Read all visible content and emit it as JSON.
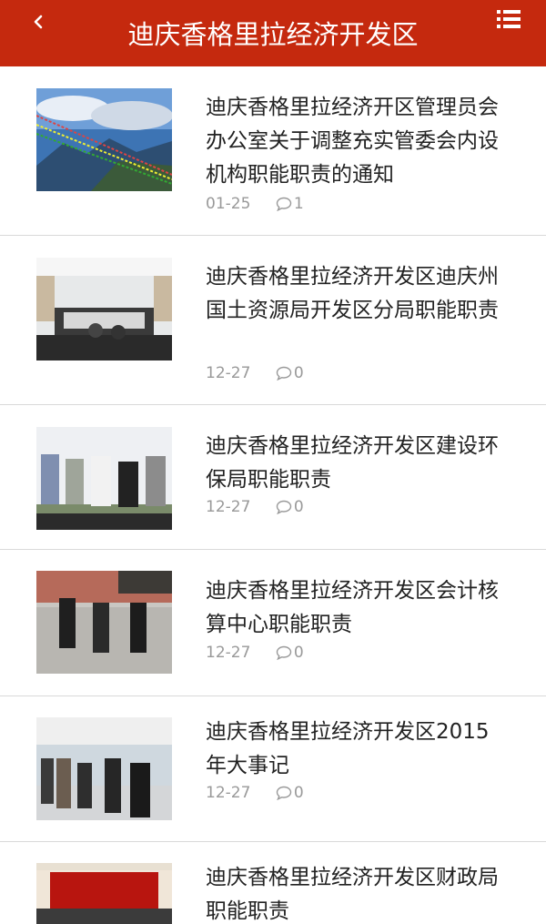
{
  "header": {
    "title": "迪庆香格里拉经济开发区",
    "back_icon": "chevron-left-icon",
    "menu_icon": "list-icon",
    "color": "#c5290e"
  },
  "articles": [
    {
      "title": "迪庆香格里拉经济开区管理员会办公室关于调整充实管委会内设机构职能职责的通知",
      "date": "01-25",
      "comments": "1",
      "image": "mountain-prayer-flags"
    },
    {
      "title": "迪庆香格里拉经济开发区迪庆州国土资源局开发区分局职能职责",
      "date": "12-27",
      "comments": "0",
      "image": "conference-room-meeting"
    },
    {
      "title": "迪庆香格里拉经济开发区建设环保局职能职责",
      "date": "12-27",
      "comments": "0",
      "image": "officials-outdoor-inspection"
    },
    {
      "title": "迪庆香格里拉经济开发区会计核算中心职能职责",
      "date": "12-27",
      "comments": "0",
      "image": "officials-walking-courtyard"
    },
    {
      "title": "迪庆香格里拉经济开发区2015年大事记",
      "date": "12-27",
      "comments": "0",
      "image": "officials-indoor-tour"
    },
    {
      "title": "迪庆香格里拉经济开发区财政局职能职责",
      "date": "",
      "comments": "",
      "image": "hall-red-curtain"
    }
  ]
}
